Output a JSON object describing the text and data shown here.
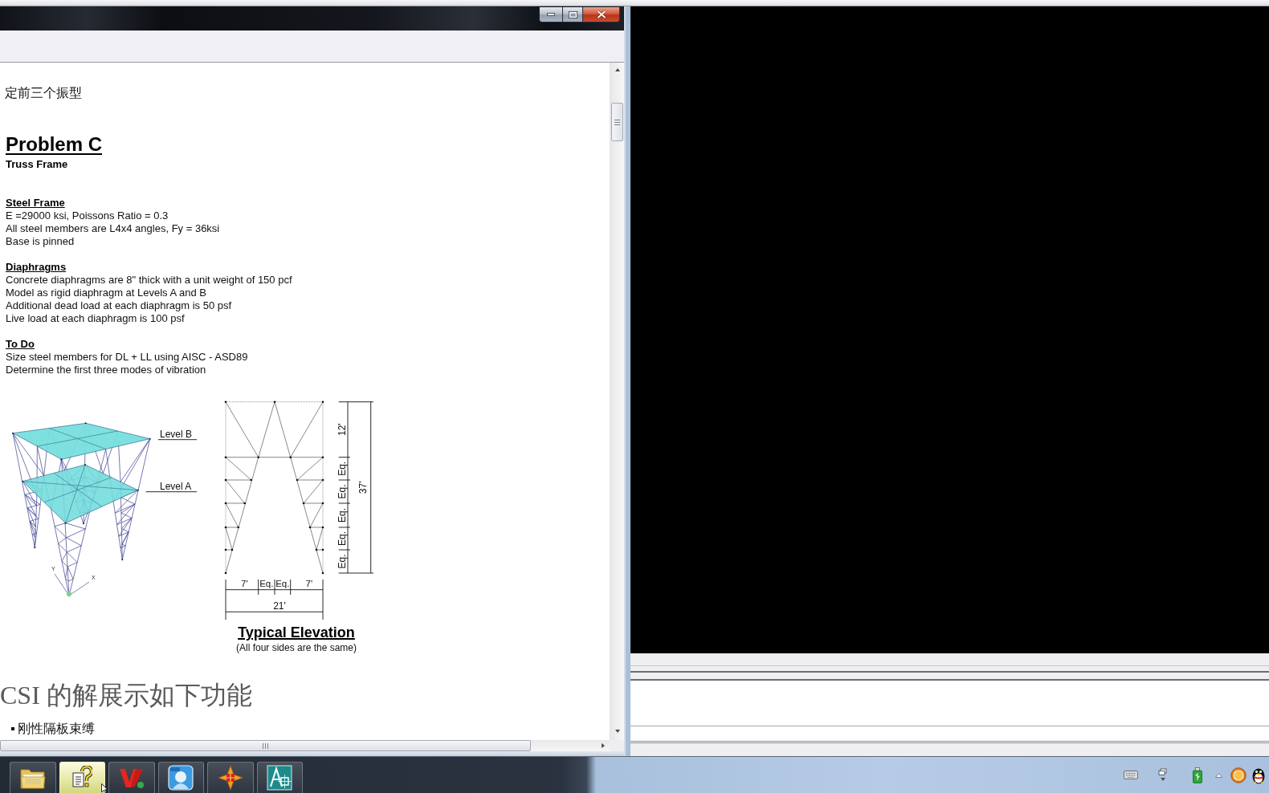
{
  "document": {
    "intro_lines": [
      "定前三个振型"
    ],
    "title": "Problem C",
    "subtitle": "Truss Frame",
    "sections": [
      {
        "heading": "Steel Frame",
        "lines": [
          "E =29000 ksi, Poissons Ratio = 0.3",
          "All steel members are L4x4 angles, Fy = 36ksi",
          "Base is pinned"
        ]
      },
      {
        "heading": "Diaphragms",
        "lines": [
          "Concrete diaphragms are 8\" thick with a unit weight of 150 pcf",
          "Model as rigid diaphragm at Levels A and B",
          "Additional dead load at each diaphragm is 50 psf",
          "Live load at each diaphragm is 100 psf"
        ]
      },
      {
        "heading": "To Do",
        "lines": [
          "Size steel members for DL + LL using AISC - ASD89",
          "Determine the first three modes of vibration"
        ]
      }
    ],
    "figure": {
      "level_labels": [
        "Level B",
        "Level A"
      ],
      "axis_labels": [
        "Y",
        "X"
      ],
      "vertical_dimensions": [
        "12'",
        "Eq.",
        "Eq.",
        "Eq.",
        "Eq.",
        "Eq."
      ],
      "total_height": "37'",
      "horizontal_dimensions": [
        "7'",
        "Eq.",
        "Eq.",
        "7'"
      ],
      "total_width": "21'",
      "caption": "Typical Elevation",
      "note": "(All four sides are the same)"
    },
    "heading_cn": "CSI 的解展示如下功能",
    "bullets": [
      "刚性隔板束缚"
    ]
  },
  "taskbar": {
    "buttons": [
      {
        "selected": false
      },
      {
        "selected": true
      },
      {
        "selected": false
      },
      {
        "selected": false
      },
      {
        "selected": false
      },
      {
        "selected": false
      }
    ]
  }
}
